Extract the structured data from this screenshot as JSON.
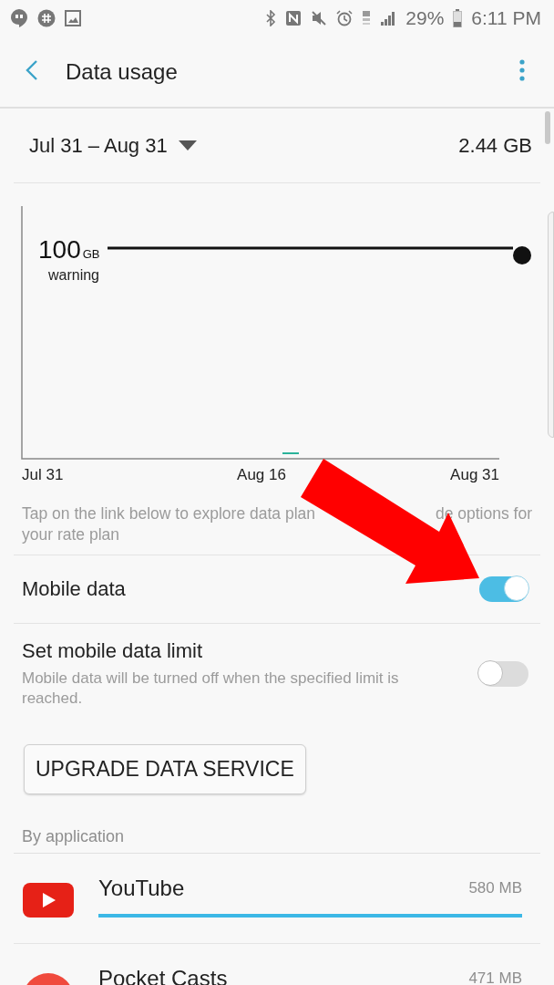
{
  "status_bar": {
    "battery": "29%",
    "time": "6:11 PM"
  },
  "header": {
    "title": "Data usage"
  },
  "period": {
    "range": "Jul 31 – Aug 31",
    "total": "2.44 GB"
  },
  "chart": {
    "warning_value": "100",
    "warning_unit": "GB",
    "warning_label": "warning",
    "x_labels": [
      "Jul 31",
      "Aug 16",
      "Aug 31"
    ]
  },
  "info": [
    "Tap on the link below to explore data plan",
    "de options for",
    "your rate plan"
  ],
  "settings": [
    {
      "kind": "toggle",
      "title": "Mobile data",
      "on": true
    },
    {
      "kind": "toggle",
      "title": "Set mobile data limit",
      "summary": "Mobile data will be turned off when the specified limit is reached.",
      "on": false
    }
  ],
  "button": "UPGRADE DATA SERVICE",
  "section": "By application",
  "apps": [
    {
      "name": "YouTube",
      "usage": "580 MB",
      "level": 1.0
    },
    {
      "name": "Pocket Casts",
      "usage": "471 MB"
    }
  ]
}
